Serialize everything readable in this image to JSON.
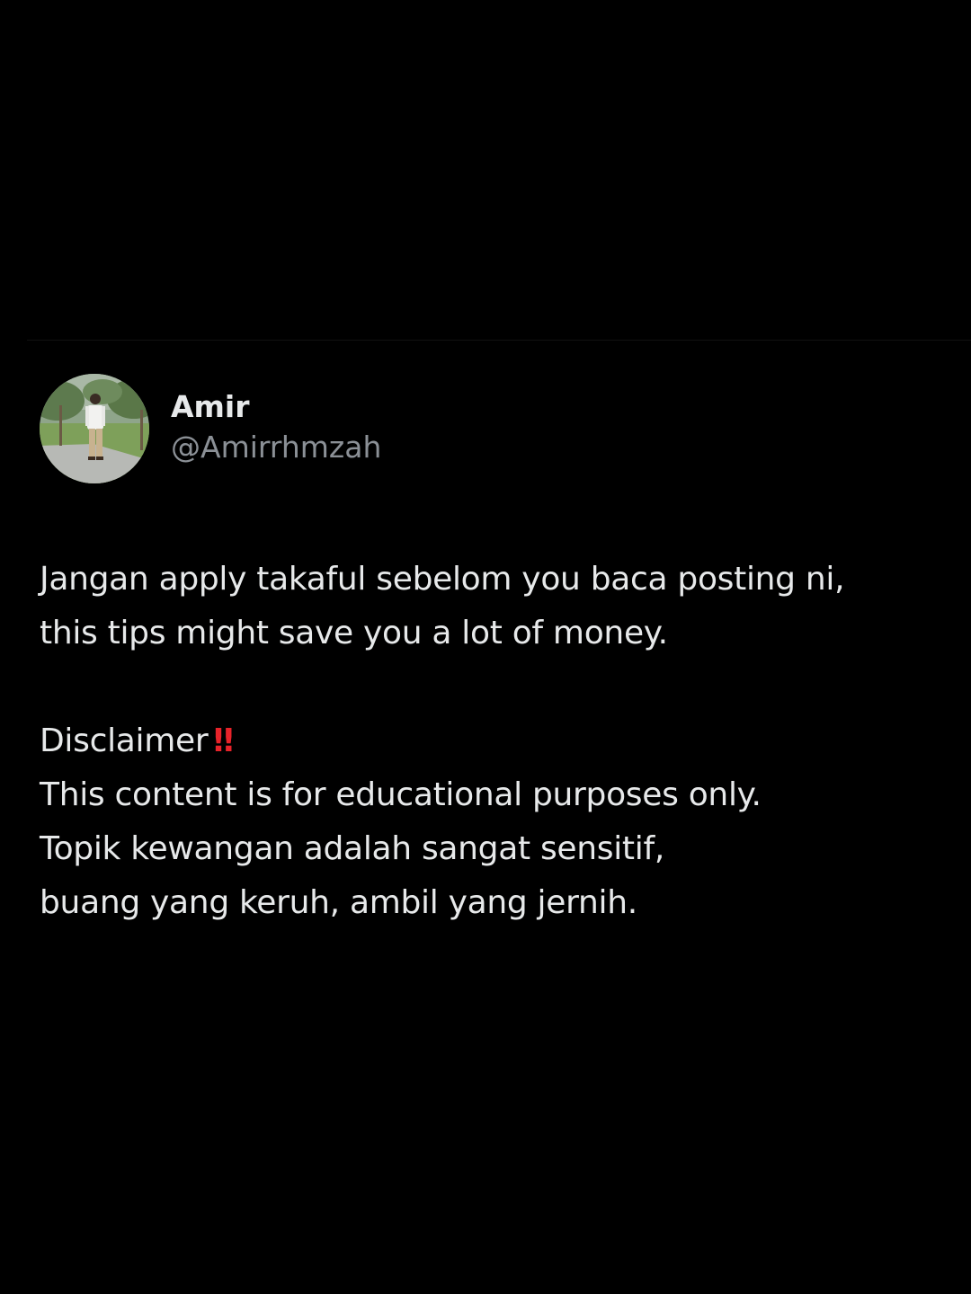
{
  "author": {
    "display_name": "Amir",
    "handle": "@Amirrhmzah",
    "avatar_icon": "profile-photo-avatar"
  },
  "post": {
    "paragraph1": [
      "Jangan apply takaful sebelom you baca posting ni,",
      "this tips might save you a lot of money."
    ],
    "disclaimer_label": "Disclaimer",
    "disclaimer_emoji": "‼",
    "paragraph2": [
      "This content is for educational purposes only.",
      "Topik kewangan adalah sangat sensitif,",
      "buang yang keruh, ambil yang jernih."
    ]
  },
  "colors": {
    "background": "#000000",
    "text": "#e7e9ea",
    "handle": "#8b9096",
    "emoji": "#e8232a"
  }
}
